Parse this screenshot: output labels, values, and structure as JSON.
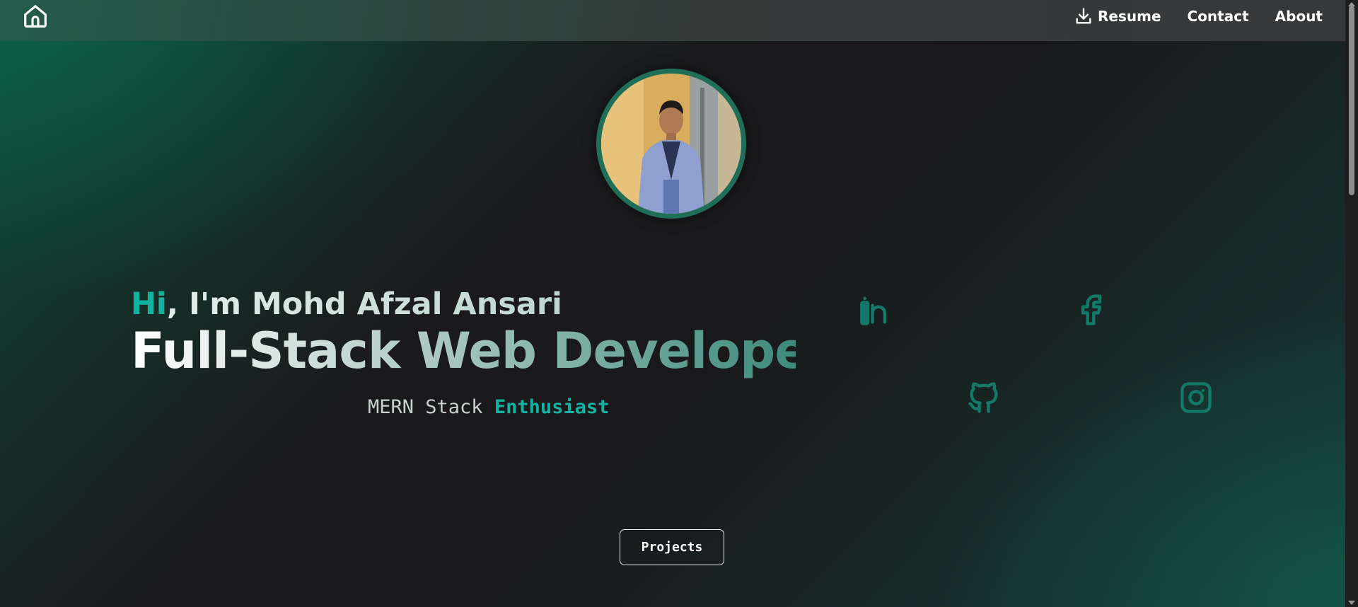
{
  "nav": {
    "home_icon": "home-icon",
    "links": [
      {
        "label": "Resume",
        "icon": "download-icon"
      },
      {
        "label": "Contact"
      },
      {
        "label": "About"
      }
    ]
  },
  "hero": {
    "greeting_hi": "Hi",
    "greeting_rest": ", I'm Mohd Afzal Ansari",
    "headline": "Full-Stack Web Developer",
    "tagline_plain": "MERN Stack ",
    "tagline_accent": "Enthusiast"
  },
  "social": [
    {
      "name": "linkedin-icon"
    },
    {
      "name": "facebook-icon"
    },
    {
      "name": "github-icon"
    },
    {
      "name": "instagram-icon"
    }
  ],
  "projects_button": {
    "label": "Projects"
  },
  "colors": {
    "accent": "#10b3a0",
    "icon_teal": "#137a6a",
    "background_dark": "#19191b"
  }
}
